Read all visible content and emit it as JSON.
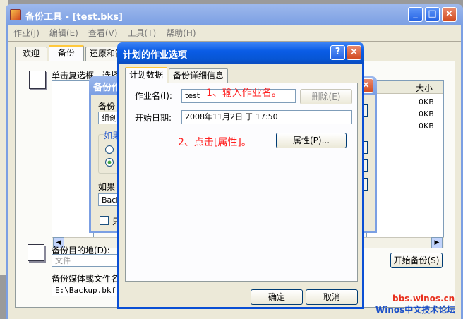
{
  "main": {
    "title": "备份工具 - [test.bks]",
    "menu": [
      "作业(J)",
      "编辑(E)",
      "查看(V)",
      "工具(T)",
      "帮助(H)"
    ],
    "tabs": [
      "欢迎",
      "备份",
      "还原和管"
    ],
    "instruction": "单击复选框，选择",
    "size_header": "大小",
    "sizes": [
      "0KB",
      "0KB",
      "0KB"
    ],
    "dest_label": "备份目的地(D):",
    "dest_value": "文件",
    "media_label": "备份媒体或文件名",
    "media_value": "E:\\Backup.bkf",
    "start_button": "开始备份(S)"
  },
  "middle": {
    "title": "备份作",
    "label1": "备份",
    "value1": "组创",
    "group1": "如果",
    "label2": "如果",
    "value2": "Back",
    "check_label": "只"
  },
  "dialog": {
    "title": "计划的作业选项",
    "help_button": "?",
    "close_button": "×",
    "tabs": [
      "计划数据",
      "备份详细信息"
    ],
    "job_name_label": "作业名(I):",
    "job_name_value": "test",
    "delete_button": "删除(E)",
    "start_date_label": "开始日期:",
    "start_date_value": "2008年11月2日 于 17:50",
    "properties_button": "属性(P)...",
    "ok_button": "确定",
    "cancel_button": "取消"
  },
  "annotations": {
    "step1": "1、输入作业名。",
    "step2": "2、点击[属性]。"
  },
  "watermark": {
    "url": "bbs.winos.cn",
    "name": "Winos中文技术论坛"
  },
  "colors": {
    "accent": "#0a5ce6",
    "annotation": "#ff2020",
    "face": "#ece9d8"
  }
}
